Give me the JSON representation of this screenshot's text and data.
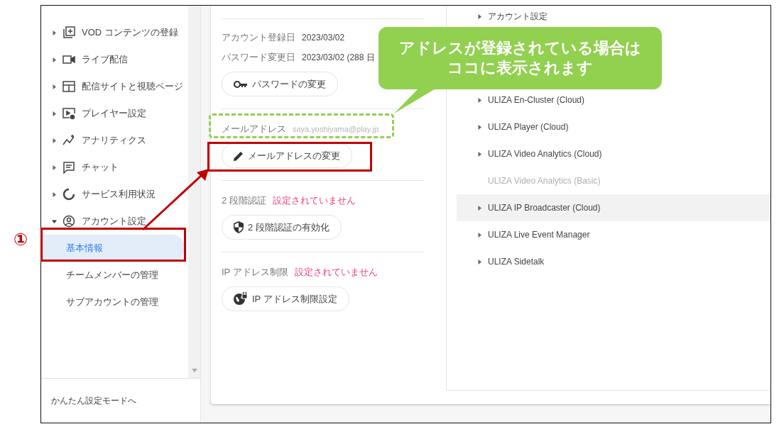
{
  "sidebar": {
    "items": [
      {
        "label": "VOD コンテンツの登録",
        "expanded": false
      },
      {
        "label": "ライブ配信",
        "expanded": false
      },
      {
        "label": "配信サイトと視聴ページ",
        "expanded": false
      },
      {
        "label": "プレイヤー設定",
        "expanded": false
      },
      {
        "label": "アナリティクス",
        "expanded": false
      },
      {
        "label": "チャット",
        "expanded": false
      },
      {
        "label": "サービス利用状況",
        "expanded": false
      },
      {
        "label": "アカウント設定",
        "expanded": true,
        "children": [
          {
            "label": "基本情報",
            "selected": true
          },
          {
            "label": "チームメンバーの管理",
            "selected": false
          },
          {
            "label": "サブアカウントの管理",
            "selected": false
          }
        ]
      }
    ],
    "footer_link": "かんたん設定モードへ"
  },
  "account": {
    "dates": [
      {
        "label": "アカウント登録日",
        "value": "2023/03/02"
      },
      {
        "label": "パスワード変更日",
        "value": "2023/03/02 (288 日"
      }
    ],
    "password_button": "パスワードの変更",
    "email": {
      "label": "メールアドレス",
      "value": "saya.yoshiyama@play.jp",
      "button": "メールアドレスの変更"
    },
    "two_factor": {
      "label": "2 段階認証",
      "status": "設定されていません",
      "button": "2 段階認証の有効化"
    },
    "ip_restriction": {
      "label": "IP アドレス制限",
      "status": "設定されていません",
      "button": "IP アドレス制限設定"
    }
  },
  "products": [
    {
      "label": "アカウント設定",
      "disabled": false,
      "highlighted": false
    },
    {
      "label": "ULIZA En-Cluster (Cloud)",
      "disabled": false,
      "highlighted": false
    },
    {
      "label": "ULIZA Player (Cloud)",
      "disabled": false,
      "highlighted": false
    },
    {
      "label": "ULIZA Video Analytics (Cloud)",
      "disabled": false,
      "highlighted": false
    },
    {
      "label": "ULIZA Video Analytics (Basic)",
      "disabled": true,
      "highlighted": false
    },
    {
      "label": "ULIZA IP Broadcaster (Cloud)",
      "disabled": false,
      "highlighted": true
    },
    {
      "label": "ULIZA Live Event Manager",
      "disabled": false,
      "highlighted": false
    },
    {
      "label": "ULIZA Sidetalk",
      "disabled": false,
      "highlighted": false
    }
  ],
  "annotations": {
    "callout": [
      "アドレスが登録されている場合は",
      "ココに表示されます"
    ],
    "step_marker": "①"
  }
}
